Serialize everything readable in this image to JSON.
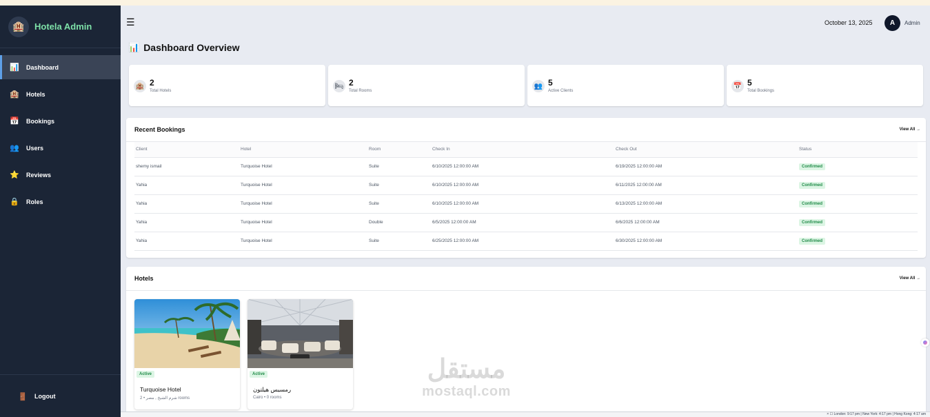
{
  "brand": {
    "name": "Hotela Admin",
    "logo_icon": "hotel-icon"
  },
  "sidebar": {
    "items": [
      {
        "label": "Dashboard",
        "icon": "chart-icon",
        "active": true
      },
      {
        "label": "Hotels",
        "icon": "hotel-icon"
      },
      {
        "label": "Bookings",
        "icon": "calendar-icon"
      },
      {
        "label": "Users",
        "icon": "users-icon"
      },
      {
        "label": "Reviews",
        "icon": "star-icon"
      },
      {
        "label": "Roles",
        "icon": "lock-icon"
      }
    ],
    "logout_label": "Logout"
  },
  "header": {
    "date": "October 13, 2025",
    "avatar_initial": "A",
    "user_name": "Admin"
  },
  "page": {
    "title": "Dashboard Overview"
  },
  "stats": [
    {
      "value": "2",
      "label": "Total Hotels",
      "icon": "hotel-icon"
    },
    {
      "value": "2",
      "label": "Total Rooms",
      "icon": "bed-icon"
    },
    {
      "value": "5",
      "label": "Active Clients",
      "icon": "users-icon"
    },
    {
      "value": "5",
      "label": "Total Bookings",
      "icon": "calendar-icon"
    }
  ],
  "recent_bookings": {
    "title": "Recent Bookings",
    "view_all": "View All →",
    "columns": [
      "Client",
      "Hotel",
      "Room",
      "Check In",
      "Check Out",
      "Status"
    ],
    "rows": [
      [
        "shemy ismail",
        "Turquoise Hotel",
        "Suite",
        "6/10/2025 12:00:00 AM",
        "6/19/2025 12:00:00 AM",
        "Confirmed"
      ],
      [
        "Yahia",
        "Turquoise Hotel",
        "Suite",
        "6/10/2025 12:00:00 AM",
        "6/11/2025 12:00:00 AM",
        "Confirmed"
      ],
      [
        "Yahia",
        "Turquoise Hotel",
        "Suite",
        "6/10/2025 12:00:00 AM",
        "6/13/2025 12:00:00 AM",
        "Confirmed"
      ],
      [
        "Yahia",
        "Turquoise Hotel",
        "Double",
        "6/5/2025 12:00:00 AM",
        "6/6/2025 12:00:00 AM",
        "Confirmed"
      ],
      [
        "Yahia",
        "Turquoise Hotel",
        "Suite",
        "6/25/2025 12:00:00 AM",
        "6/30/2025 12:00:00 AM",
        "Confirmed"
      ]
    ]
  },
  "hotels": {
    "title": "Hotels",
    "view_all": "View All →",
    "items": [
      {
        "name": "Turquoise Hotel",
        "meta": "شرم الشيخ , مصر • 2 rooms",
        "status": "Active"
      },
      {
        "name": "رمسيس هيلتون",
        "meta": "Cairo • 0 rooms",
        "status": "Active"
      }
    ]
  },
  "watermark": {
    "arabic": "مستقل",
    "latin": "mostaql.com"
  },
  "taskbar": {
    "clocks": "× ☐ London: 9:17 pm | New York: 4:17 pm | Hong Kong: 4:17 am"
  },
  "colors": {
    "sidebar_bg": "#1b2536",
    "brand_text": "#7ee2a8",
    "badge_bg": "#dcf5e4",
    "badge_text": "#1f8a47",
    "active_border": "#5ea0e8"
  }
}
